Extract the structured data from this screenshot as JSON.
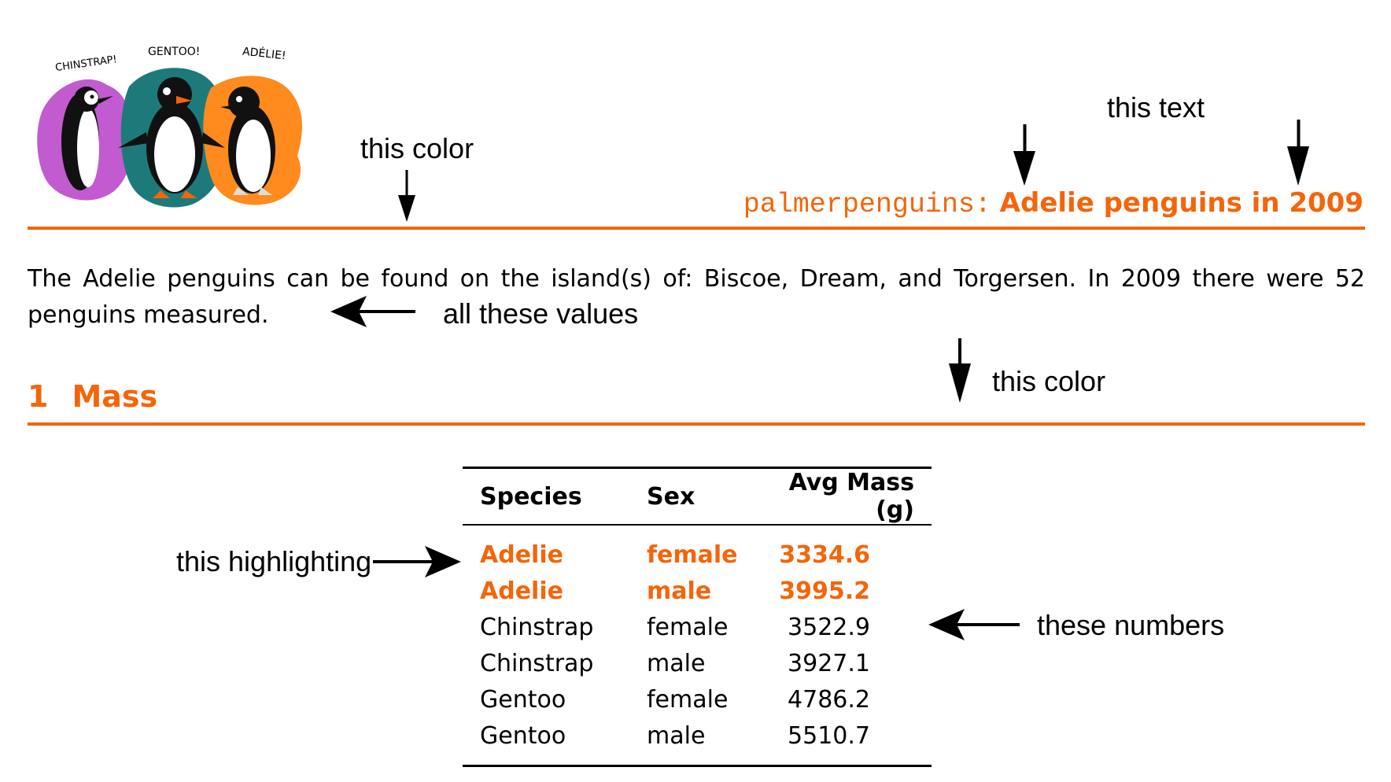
{
  "accent_color": "#F4650A",
  "illustration": {
    "labels": [
      "CHINSTRAP!",
      "GENTOO!",
      "ADÉLIE!"
    ],
    "colors": {
      "chinstrap": "#C35BD0",
      "gentoo": "#1E7A7A",
      "adelie": "#FF8A1E"
    }
  },
  "header": {
    "package": "palmerpenguins:",
    "title": "Adelie penguins in 2009"
  },
  "intro": {
    "text": "The Adelie penguins can be found on the island(s) of: Biscoe, Dream, and Torgersen. In 2009 there were 52 penguins measured."
  },
  "section": {
    "number": "1",
    "title": "Mass"
  },
  "table": {
    "headers": [
      "Species",
      "Sex",
      "Avg Mass (g)"
    ],
    "rows": [
      {
        "species": "Adelie",
        "sex": "female",
        "mass": "3334.6",
        "highlight": true
      },
      {
        "species": "Adelie",
        "sex": "male",
        "mass": "3995.2",
        "highlight": true
      },
      {
        "species": "Chinstrap",
        "sex": "female",
        "mass": "3522.9",
        "highlight": false
      },
      {
        "species": "Chinstrap",
        "sex": "male",
        "mass": "3927.1",
        "highlight": false
      },
      {
        "species": "Gentoo",
        "sex": "female",
        "mass": "4786.2",
        "highlight": false
      },
      {
        "species": "Gentoo",
        "sex": "male",
        "mass": "5510.7",
        "highlight": false
      }
    ]
  },
  "annotations": {
    "this_color_1": "this color",
    "this_text": "this text",
    "all_these_values": "all these values",
    "this_color_2": "this color",
    "this_highlighting": "this highlighting",
    "these_numbers": "these numbers"
  }
}
